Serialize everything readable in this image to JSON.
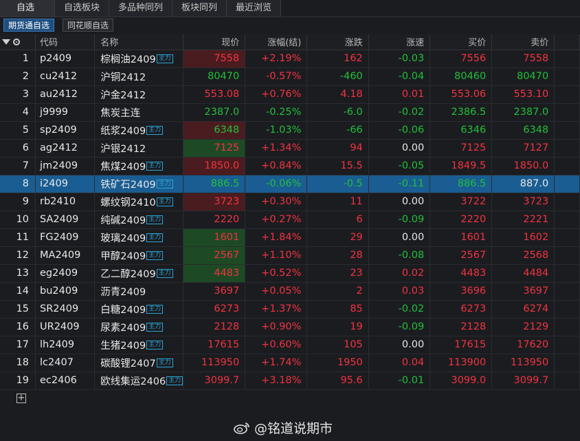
{
  "tabs": [
    "自选",
    "自选板块",
    "多品种同列",
    "板块同列",
    "最近浏览"
  ],
  "subtabs": [
    "期货通自选",
    "同花顺自选"
  ],
  "columns": [
    "代码",
    "名称",
    "现价",
    "涨幅(结)",
    "涨跌",
    "涨速",
    "买价",
    "卖价"
  ],
  "badge_label": "主力",
  "add_row_symbol": "+",
  "watermark": "@铭道说期市",
  "rows": [
    {
      "idx": "1",
      "code": "p2409",
      "name": "棕榈油2409",
      "badge": true,
      "price": "7558",
      "chg_pct": "+2.19%",
      "chg": "162",
      "speed": "-0.03",
      "bid": "7556",
      "ask": "7558",
      "price_color": "red",
      "pct_color": "red",
      "chg_color": "red",
      "speed_color": "green",
      "bid_color": "red",
      "ask_color": "red",
      "price_bg": "red"
    },
    {
      "idx": "2",
      "code": "cu2412",
      "name": "沪铜2412",
      "badge": false,
      "price": "80470",
      "chg_pct": "-0.57%",
      "chg": "-460",
      "speed": "-0.04",
      "bid": "80460",
      "ask": "80470",
      "price_color": "green",
      "pct_color": "red",
      "chg_color": "green",
      "speed_color": "green",
      "bid_color": "green",
      "ask_color": "green",
      "price_bg": ""
    },
    {
      "idx": "3",
      "code": "au2412",
      "name": "沪金2412",
      "badge": false,
      "price": "553.08",
      "chg_pct": "+0.76%",
      "chg": "4.18",
      "speed": "0.01",
      "bid": "553.06",
      "ask": "553.10",
      "price_color": "red",
      "pct_color": "red",
      "chg_color": "red",
      "speed_color": "red",
      "bid_color": "red",
      "ask_color": "red",
      "price_bg": ""
    },
    {
      "idx": "4",
      "code": "j9999",
      "name": "焦炭主连",
      "badge": false,
      "price": "2387.0",
      "chg_pct": "-0.25%",
      "chg": "-6.0",
      "speed": "-0.02",
      "bid": "2386.5",
      "ask": "2387.0",
      "price_color": "green",
      "pct_color": "green",
      "chg_color": "green",
      "speed_color": "green",
      "bid_color": "green",
      "ask_color": "green",
      "price_bg": ""
    },
    {
      "idx": "5",
      "code": "sp2409",
      "name": "纸浆2409",
      "badge": true,
      "price": "6348",
      "chg_pct": "-1.03%",
      "chg": "-66",
      "speed": "-0.06",
      "bid": "6346",
      "ask": "6348",
      "price_color": "green",
      "pct_color": "green",
      "chg_color": "green",
      "speed_color": "green",
      "bid_color": "green",
      "ask_color": "green",
      "price_bg": "red"
    },
    {
      "idx": "6",
      "code": "ag2412",
      "name": "沪银2412",
      "badge": false,
      "price": "7125",
      "chg_pct": "+1.34%",
      "chg": "94",
      "speed": "0.00",
      "bid": "7125",
      "ask": "7127",
      "price_color": "red",
      "pct_color": "red",
      "chg_color": "red",
      "speed_color": "white",
      "bid_color": "red",
      "ask_color": "red",
      "price_bg": "green"
    },
    {
      "idx": "7",
      "code": "jm2409",
      "name": "焦煤2409",
      "badge": true,
      "price": "1850.0",
      "chg_pct": "+0.84%",
      "chg": "15.5",
      "speed": "-0.05",
      "bid": "1849.5",
      "ask": "1850.0",
      "price_color": "red",
      "pct_color": "red",
      "chg_color": "red",
      "speed_color": "green",
      "bid_color": "red",
      "ask_color": "red",
      "price_bg": "red"
    },
    {
      "idx": "8",
      "code": "i2409",
      "name": "铁矿石2409",
      "badge": true,
      "price": "886.5",
      "chg_pct": "-0.06%",
      "chg": "-0.5",
      "speed": "-0.11",
      "bid": "886.5",
      "ask": "887.0",
      "price_color": "green",
      "pct_color": "green",
      "chg_color": "green",
      "speed_color": "green",
      "bid_color": "green",
      "ask_color": "white",
      "price_bg": "",
      "selected": true
    },
    {
      "idx": "9",
      "code": "rb2410",
      "name": "螺纹钢2410",
      "badge": true,
      "price": "3723",
      "chg_pct": "+0.30%",
      "chg": "11",
      "speed": "0.00",
      "bid": "3722",
      "ask": "3723",
      "price_color": "red",
      "pct_color": "red",
      "chg_color": "red",
      "speed_color": "white",
      "bid_color": "red",
      "ask_color": "red",
      "price_bg": "red"
    },
    {
      "idx": "10",
      "code": "SA2409",
      "name": "纯碱2409",
      "badge": true,
      "price": "2220",
      "chg_pct": "+0.27%",
      "chg": "6",
      "speed": "-0.09",
      "bid": "2220",
      "ask": "2221",
      "price_color": "red",
      "pct_color": "red",
      "chg_color": "red",
      "speed_color": "green",
      "bid_color": "red",
      "ask_color": "red",
      "price_bg": ""
    },
    {
      "idx": "11",
      "code": "FG2409",
      "name": "玻璃2409",
      "badge": true,
      "price": "1601",
      "chg_pct": "+1.84%",
      "chg": "29",
      "speed": "0.00",
      "bid": "1601",
      "ask": "1602",
      "price_color": "red",
      "pct_color": "red",
      "chg_color": "red",
      "speed_color": "white",
      "bid_color": "red",
      "ask_color": "red",
      "price_bg": "green"
    },
    {
      "idx": "12",
      "code": "MA2409",
      "name": "甲醇2409",
      "badge": true,
      "price": "2567",
      "chg_pct": "+1.10%",
      "chg": "28",
      "speed": "-0.08",
      "bid": "2567",
      "ask": "2568",
      "price_color": "red",
      "pct_color": "red",
      "chg_color": "red",
      "speed_color": "green",
      "bid_color": "red",
      "ask_color": "red",
      "price_bg": "green"
    },
    {
      "idx": "13",
      "code": "eg2409",
      "name": "乙二醇2409",
      "badge": true,
      "price": "4483",
      "chg_pct": "+0.52%",
      "chg": "23",
      "speed": "0.02",
      "bid": "4483",
      "ask": "4484",
      "price_color": "red",
      "pct_color": "red",
      "chg_color": "red",
      "speed_color": "red",
      "bid_color": "red",
      "ask_color": "red",
      "price_bg": "green"
    },
    {
      "idx": "14",
      "code": "bu2409",
      "name": "沥青2409",
      "badge": false,
      "price": "3697",
      "chg_pct": "+0.05%",
      "chg": "2",
      "speed": "0.03",
      "bid": "3696",
      "ask": "3697",
      "price_color": "red",
      "pct_color": "red",
      "chg_color": "red",
      "speed_color": "red",
      "bid_color": "red",
      "ask_color": "red",
      "price_bg": ""
    },
    {
      "idx": "15",
      "code": "SR2409",
      "name": "白糖2409",
      "badge": true,
      "price": "6273",
      "chg_pct": "+1.37%",
      "chg": "85",
      "speed": "-0.02",
      "bid": "6273",
      "ask": "6274",
      "price_color": "red",
      "pct_color": "red",
      "chg_color": "red",
      "speed_color": "green",
      "bid_color": "red",
      "ask_color": "red",
      "price_bg": ""
    },
    {
      "idx": "16",
      "code": "UR2409",
      "name": "尿素2409",
      "badge": true,
      "price": "2128",
      "chg_pct": "+0.90%",
      "chg": "19",
      "speed": "-0.09",
      "bid": "2128",
      "ask": "2129",
      "price_color": "red",
      "pct_color": "red",
      "chg_color": "red",
      "speed_color": "green",
      "bid_color": "red",
      "ask_color": "red",
      "price_bg": ""
    },
    {
      "idx": "17",
      "code": "lh2409",
      "name": "生猪2409",
      "badge": true,
      "price": "17615",
      "chg_pct": "+0.60%",
      "chg": "105",
      "speed": "0.00",
      "bid": "17615",
      "ask": "17620",
      "price_color": "red",
      "pct_color": "red",
      "chg_color": "red",
      "speed_color": "white",
      "bid_color": "red",
      "ask_color": "red",
      "price_bg": ""
    },
    {
      "idx": "18",
      "code": "lc2407",
      "name": "碳酸锂2407",
      "badge": true,
      "price": "113950",
      "chg_pct": "+1.74%",
      "chg": "1950",
      "speed": "0.04",
      "bid": "113900",
      "ask": "113950",
      "price_color": "red",
      "pct_color": "red",
      "chg_color": "red",
      "speed_color": "red",
      "bid_color": "red",
      "ask_color": "red",
      "price_bg": ""
    },
    {
      "idx": "19",
      "code": "ec2406",
      "name": "欧线集运2406",
      "badge": true,
      "price": "3099.7",
      "chg_pct": "+3.18%",
      "chg": "95.6",
      "speed": "-0.01",
      "bid": "3099.0",
      "ask": "3099.7",
      "price_color": "red",
      "pct_color": "red",
      "chg_color": "red",
      "speed_color": "green",
      "bid_color": "red",
      "ask_color": "red",
      "price_bg": ""
    }
  ]
}
